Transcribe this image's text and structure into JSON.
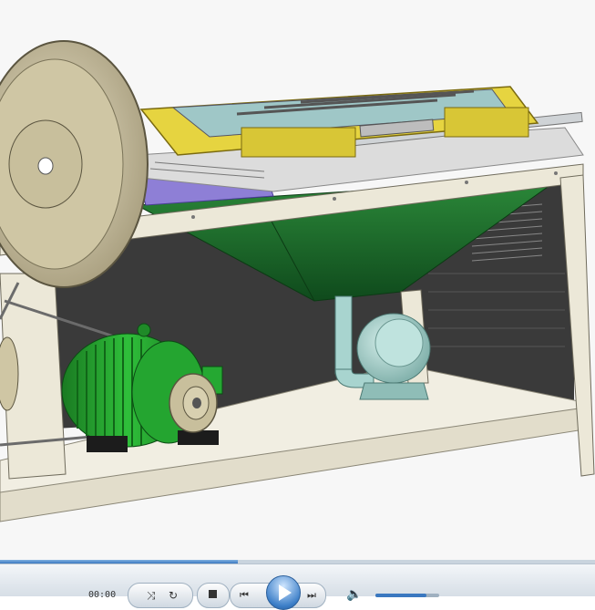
{
  "player": {
    "time_text": "00:00",
    "progress": 0.4,
    "volume": 0.8,
    "icons": {
      "shuffle": "shuffle-icon",
      "repeat": "repeat-icon",
      "stop": "stop-icon",
      "previous": "previous-icon",
      "play": "play-icon",
      "next": "next-icon",
      "volume": "speaker-icon"
    }
  },
  "colors": {
    "frame": "#ece8d8",
    "hopper": "#1d6a2c",
    "motor": "#1f9a2a",
    "pulley": "#d8d0b0",
    "tray": "#e6d440",
    "blower": "#a8d4cf",
    "accent": "#3a78c0"
  }
}
